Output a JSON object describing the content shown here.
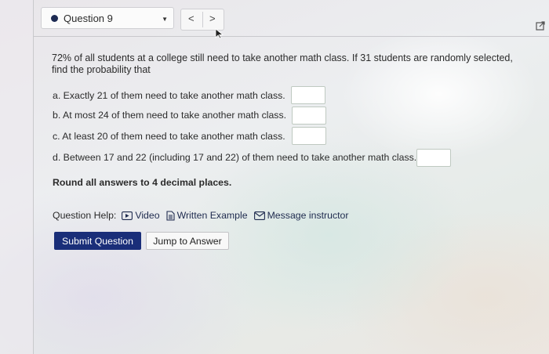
{
  "header": {
    "question_selector": {
      "label": "Question 9"
    },
    "nav": {
      "prev": "<",
      "next": ">"
    }
  },
  "question": {
    "prompt": "72% of all students at a college still need to take another math class. If 31 students are randomly selected, find the probability that",
    "parts": [
      {
        "label": "a. Exactly 21 of them need to take another math class.",
        "value": ""
      },
      {
        "label": "b. At most 24 of them need to take another math class.",
        "value": ""
      },
      {
        "label": "c. At least 20 of them need to take another math class.",
        "value": ""
      },
      {
        "label": "d. Between 17 and 22 (including 17 and 22) of them need to take another math class.",
        "value": ""
      }
    ],
    "rounding_note": "Round all answers to 4 decimal places."
  },
  "help": {
    "label": "Question Help:",
    "video": "Video",
    "written_example": "Written Example",
    "message_instructor": "Message instructor"
  },
  "actions": {
    "submit": "Submit Question",
    "jump": "Jump to Answer"
  },
  "colors": {
    "primary": "#1a2e79",
    "dot": "#1c2a52"
  }
}
